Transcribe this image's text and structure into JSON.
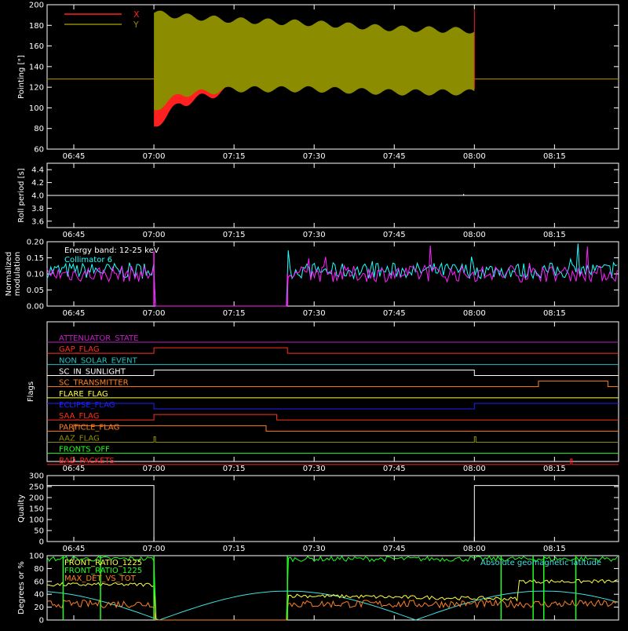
{
  "time_ticks": [
    "06:45",
    "07:00",
    "07:15",
    "07:30",
    "07:45",
    "08:00",
    "08:15"
  ],
  "chart_data": [
    {
      "type": "line",
      "ylabel": "Pointing [\"]",
      "ylim": [
        60,
        200
      ],
      "yticks": [
        "60",
        "80",
        "100",
        "120",
        "140",
        "160",
        "180",
        "200"
      ],
      "legend": "top-left",
      "series": [
        {
          "name": "X",
          "color": "#ff2020",
          "before": 128,
          "after": 128,
          "envelope": {
            "t": [
              "07:00",
              "07:05",
              "07:15",
              "07:30",
              "07:45",
              "08:00"
            ],
            "hi": [
              150,
              145,
              150,
              155,
              160,
              165
            ],
            "lo": [
              78,
              100,
              115,
              118,
              118,
              118
            ]
          }
        },
        {
          "name": "Y",
          "color": "#8c8c00",
          "before": 128,
          "after": 128,
          "envelope": {
            "t": [
              "07:00",
              "07:05",
              "07:15",
              "07:30",
              "07:45",
              "08:00"
            ],
            "hi": [
              195,
              192,
              188,
              185,
              180,
              178
            ],
            "lo": [
              95,
              110,
              115,
              115,
              112,
              112
            ]
          }
        }
      ]
    },
    {
      "type": "line",
      "ylabel": "Roll period [s]",
      "ylim": [
        3.5,
        4.5
      ],
      "yticks": [
        "3.6",
        "3.8",
        "4.0",
        "4.2",
        "4.4"
      ],
      "series": [
        {
          "name": "",
          "color": "#ffffff",
          "value": 4.0
        }
      ]
    },
    {
      "type": "line",
      "ylabel": "Normalized modulation",
      "ylim": [
        0,
        0.2
      ],
      "yticks": [
        "0.00",
        "0.05",
        "0.10",
        "0.15",
        "0.20"
      ],
      "annotation": "Energy band: 12-25 keV",
      "series": [
        {
          "name": "Collimator 6",
          "color": "#20ffff",
          "mean": 0.11,
          "gap": [
            "07:00",
            "07:25"
          ]
        },
        {
          "name": "",
          "color": "#ff20ff",
          "mean": 0.1,
          "gap": [
            "07:00",
            "07:25"
          ]
        }
      ]
    },
    {
      "type": "line",
      "ylabel": "Flags",
      "flags": [
        {
          "name": "ATTENUATOR_STATE",
          "color": "#c020c0",
          "steps": []
        },
        {
          "name": "GAP_FLAG",
          "color": "#ff3020",
          "steps": [
            [
              "07:00",
              "07:25"
            ]
          ]
        },
        {
          "name": "NON_SOLAR_EVENT",
          "color": "#20c0c0",
          "steps": []
        },
        {
          "name": "SC_IN_SUNLIGHT",
          "color": "#ffffff",
          "steps": [
            [
              "07:00",
              "08:00"
            ]
          ]
        },
        {
          "name": "SC_TRANSMITTER",
          "color": "#ff8020",
          "steps": [
            [
              "08:12",
              "08:25"
            ]
          ]
        },
        {
          "name": "FLARE_FLAG",
          "color": "#ffff40",
          "steps": []
        },
        {
          "name": "ECLIPSE_FLAG",
          "color": "#2020ff",
          "steps": [
            [
              "07:00",
              "08:00"
            ]
          ],
          "inverted": true
        },
        {
          "name": "SAA_FLAG",
          "color": "#ff3020",
          "steps": [
            [
              "07:00",
              "07:23"
            ]
          ]
        },
        {
          "name": "PARTICLE_FLAG",
          "color": "#ff8020",
          "steps": [
            [
              "06:45",
              "07:21"
            ]
          ]
        },
        {
          "name": "AAZ_FLAG",
          "color": "#8c8c00",
          "steps": [
            [
              "07:00",
              "07:00"
            ],
            [
              "08:00",
              "08:00"
            ]
          ]
        },
        {
          "name": "FRONTS_OFF",
          "color": "#20ff20",
          "steps": []
        },
        {
          "name": "BAD_PACKETS",
          "color": "#ff2020",
          "steps": [
            [
              "08:18",
              "08:18"
            ]
          ]
        }
      ]
    },
    {
      "type": "line",
      "ylabel": "Quality",
      "ylim": [
        0,
        300
      ],
      "yticks": [
        "0",
        "50",
        "100",
        "150",
        "200",
        "250",
        "300"
      ],
      "series": [
        {
          "name": "",
          "color": "#ffffff",
          "high": 255,
          "low": 0,
          "low_range": [
            "07:00",
            "08:00"
          ]
        }
      ]
    },
    {
      "type": "line",
      "ylabel": "Degrees or %",
      "ylim": [
        0,
        100
      ],
      "yticks": [
        "0",
        "20",
        "40",
        "60",
        "80",
        "100"
      ],
      "series": [
        {
          "name": "FRONT_RATIO_1225",
          "color": "#ffff40"
        },
        {
          "name": "FRONT_RATIO_1225",
          "color": "#20ff20"
        },
        {
          "name": "MAX_DET_VS_TOT",
          "color": "#ff8020"
        },
        {
          "name": "Absolute geomagnetic latitude",
          "color": "#40e0e0"
        }
      ]
    }
  ]
}
